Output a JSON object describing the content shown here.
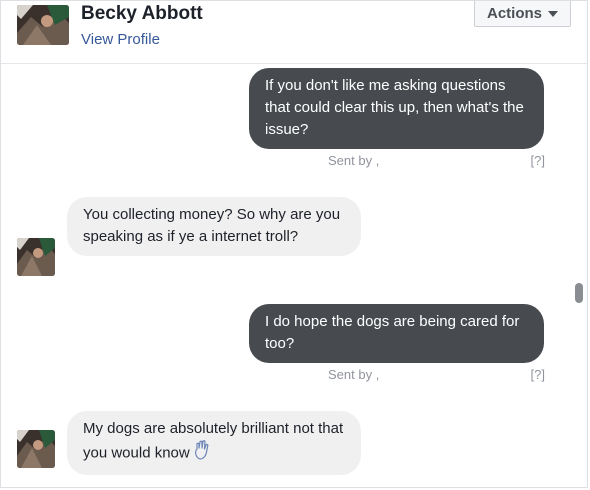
{
  "header": {
    "contact_name": "Becky Abbott",
    "view_profile_label": "View Profile",
    "actions_label": "Actions"
  },
  "messages": [
    {
      "direction": "outgoing",
      "text": "If you don't like me asking questions that could clear this up, then what's the issue?",
      "sent_label": "Sent by ,",
      "help_label": "[?]"
    },
    {
      "direction": "incoming",
      "text": "You collecting money? So why are you speaking as if ye a internet troll?"
    },
    {
      "direction": "outgoing",
      "text": "I do hope the dogs are being cared for too?",
      "sent_label": "Sent by ,",
      "help_label": "[?]"
    },
    {
      "direction": "incoming",
      "text": "My dogs are absolutely brilliant not that you would know",
      "emoji": "raised-hand-icon"
    }
  ],
  "colors": {
    "outgoing_bubble": "#474b50",
    "incoming_bubble": "#f1f0f0",
    "link": "#365899"
  }
}
